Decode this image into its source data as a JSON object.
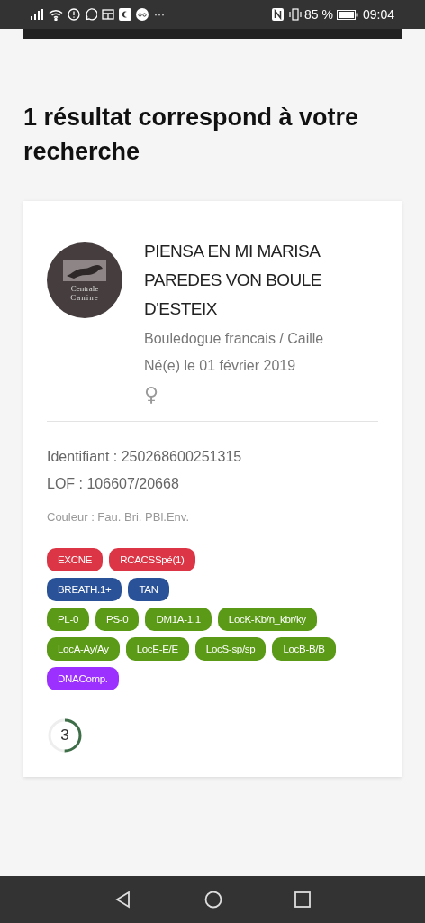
{
  "status_bar": {
    "time": "09:04",
    "battery": "85 %",
    "more": "···"
  },
  "heading": "1 résultat correspond à votre recherche",
  "result": {
    "logo_text": [
      "Centrale",
      "Canine"
    ],
    "name": "PIENSA EN MI MARISA PAREDES VON BOULE D'ESTEIX",
    "breed": "Bouledogue francais / Caille",
    "birth": "Né(e) le 01 février 2019",
    "sex_symbol": "♀",
    "identifier": "Identifiant : 250268600251315",
    "lof": "LOF : 106607/20668",
    "color_text": "Couleur : Fau. Bri. PBl.Env.",
    "badge_rows": [
      [
        {
          "label": "EXCNE",
          "color": "#dc3545"
        },
        {
          "label": "RCACSSpé(1)",
          "color": "#dc3545"
        }
      ],
      [
        {
          "label": "BREATH.1+",
          "color": "#2a5298"
        },
        {
          "label": "TAN",
          "color": "#2a5298"
        }
      ],
      [
        {
          "label": "PL-0",
          "color": "#5a9a16"
        },
        {
          "label": "PS-0",
          "color": "#5a9a16"
        },
        {
          "label": "DM1A-1.1",
          "color": "#5a9a16"
        },
        {
          "label": "LocK-Kb/n_kbr/ky",
          "color": "#5a9a16"
        }
      ],
      [
        {
          "label": "LocA-Ay/Ay",
          "color": "#5a9a16"
        },
        {
          "label": "LocE-E/E",
          "color": "#5a9a16"
        },
        {
          "label": "LocS-sp/sp",
          "color": "#5a9a16"
        },
        {
          "label": "LocB-B/B",
          "color": "#5a9a16"
        }
      ],
      [
        {
          "label": "DNAComp.",
          "color": "#9b30ff"
        }
      ]
    ],
    "score": {
      "value": "3",
      "level": 0.5
    }
  }
}
